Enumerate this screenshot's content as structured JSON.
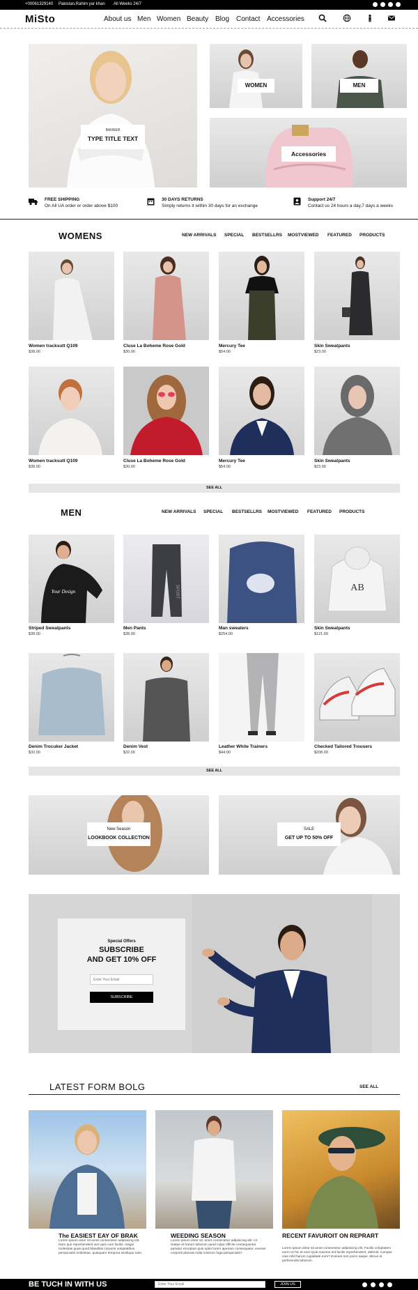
{
  "topbar": {
    "phone": "+00061329140",
    "location": "Pakistan,Rahim yar khan",
    "hours": "All Weeks 24/7",
    "social_icons": [
      "facebook-icon",
      "twitter-icon",
      "youtube-icon",
      "pinterest-icon"
    ]
  },
  "header": {
    "logo": "MiSto",
    "nav": [
      "About us",
      "Men",
      "Women",
      "Beauty",
      "Blog",
      "Contact",
      "Accessories"
    ],
    "icons": [
      "search-icon",
      "globe-icon",
      "user-icon",
      "mail-icon"
    ]
  },
  "hero": {
    "banner_small": "BANNER",
    "banner_title": "TYPE TITLE TEXT",
    "women_label": "WOMEN",
    "men_label": "MEN",
    "accessories_label": "Accessories"
  },
  "features": [
    {
      "icon": "truck-icon",
      "title": "FREE SHIPPING",
      "text": "On All UA order or order above $100"
    },
    {
      "icon": "calendar-icon",
      "title": "30 DAYS RETURNS",
      "text": "Simply returns it within 30 days for an exchange"
    },
    {
      "icon": "contact-icon",
      "title": "Support 24/7",
      "text": "Contact us 24 hours a day,7 days a weeks"
    }
  ],
  "womens": {
    "title": "WOMENS",
    "tabs": [
      "NEW ARRIVALS",
      "SPECIAL",
      "BESTSELLRS",
      "MOSTVIEWED",
      "FEATURED",
      "PRODUCTS"
    ],
    "products": [
      {
        "name": "Women tracksutt Q109",
        "price": "$38.00"
      },
      {
        "name": "Cluse La Boheme Rose Gold",
        "price": "$30.00"
      },
      {
        "name": "Mercury Tee",
        "price": "$54.00"
      },
      {
        "name": "Skin Sweatpants",
        "price": "$23.00"
      },
      {
        "name": "Women tracksutt Q109",
        "price": "$38.00"
      },
      {
        "name": "Cluse La Boheme Rose Gold",
        "price": "$30.00"
      },
      {
        "name": "Mercury Tee",
        "price": "$54.00"
      },
      {
        "name": "Skin Sweatpants",
        "price": "$23.00"
      }
    ],
    "see_all": "SEE ALL"
  },
  "men": {
    "title": "MEN",
    "tabs": [
      "NEW ARRIVALS",
      "SPECIAL",
      "BESTSELLRS",
      "MOSTVIEWED",
      "FEATURED",
      "PRODUCTS"
    ],
    "products": [
      {
        "name": "Striped Sweatpants",
        "price": "$38.00"
      },
      {
        "name": "Men Pants",
        "price": "$38.00"
      },
      {
        "name": "Man sweaters",
        "price": "$254.00"
      },
      {
        "name": "Skin Sweatpants",
        "price": "$121.00"
      },
      {
        "name": "Denim Trocuker Jacket",
        "price": "$32.00"
      },
      {
        "name": "Denim Vest",
        "price": "$32.00"
      },
      {
        "name": "Leather White Trainers",
        "price": "$44.00"
      },
      {
        "name": "Checked Tailored Trousers",
        "price": "$208.00"
      }
    ],
    "see_all": "SEE ALL",
    "print_text": {
      "sweatshirt": "Your Design",
      "pants": "SPORT",
      "hoodie": "AB"
    }
  },
  "promos": {
    "left_small": "New Season",
    "left_title": "LOOKBOOK COLLECTION",
    "right_small": "SALE",
    "right_title": "GET UP TO 50% OFF"
  },
  "subscribe": {
    "small": "Special Offers",
    "title_line1": "SUBSCRIBE",
    "title_line2": "AND GET 10% OFF",
    "placeholder": "Enter Your Email",
    "button": "SUBSCRIBE"
  },
  "blog": {
    "title": "LATEST FORM BOLG",
    "see_all": "SEE ALL",
    "posts": [
      {
        "title": "The EASIEST EAY OF BRAK",
        "text": "Lorem ipsum dolor sit amet consectetur adipisicing elit. Nam quo reprehenderit iure quis cum facilis. magni molestias quas quod blanditiis corporis voluptatibus perspiciatis molestiae, quisquam tempora similique nam."
      },
      {
        "title": "WEEDING SEASON",
        "text": "Lorem ipsum dolor sit, amet consectetur adipisicing elit. Ut. Saepe et harum laborum quod culpa officiis consequuntur pariatur excepturi quis optio lorem aperiam consequatur, eveniet corporis placeat nulla nostrum fuga perspiciatis?"
      },
      {
        "title": "RECENT FAVUROIT ON REPRART",
        "text": "Lorem ipsum dolor sit amet consectetur adipisicing elit. Facilis voluptatem eum! Ut hic et eos! Quis maxime est facilis reprehenderit, deleniti, cumque eius nihil harum cupiditate eum? Eveniet rem porro saepe. Minus et perferendis laborum."
      }
    ]
  },
  "footer": {
    "title": "BE TUCH IN WITH US",
    "placeholder": "Enter Your Email",
    "button": "JOIN US",
    "social_icons": [
      "facebook-icon",
      "twitter-icon",
      "youtube-icon",
      "pinterest-icon"
    ]
  },
  "colors": {
    "black": "#000000",
    "placeholder_gray": "#dcdcdc",
    "navy": "#1f2f5c"
  }
}
